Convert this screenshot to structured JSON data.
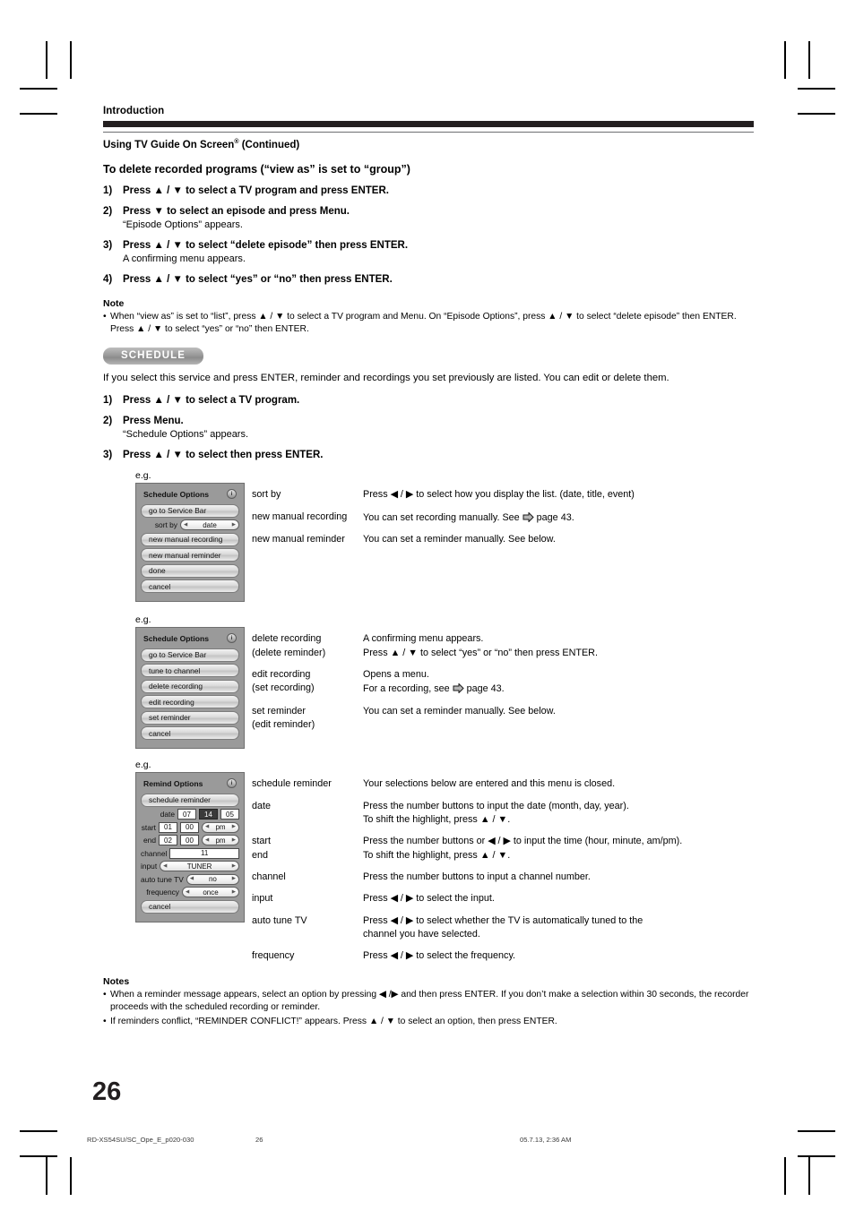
{
  "running_head": "Introduction",
  "section_title_main": "Using TV Guide On Screen",
  "section_title_sup": "®",
  "section_title_tail": " (Continued)",
  "subhead": "To delete recorded programs (“view as” is set to “group”)",
  "steps_top": [
    {
      "num": "1)",
      "text": "Press ▲ / ▼ to select a TV program and press ENTER.",
      "sub": null
    },
    {
      "num": "2)",
      "text": "Press ▼ to select an episode and press Menu.",
      "sub": "“Episode Options” appears."
    },
    {
      "num": "3)",
      "text": "Press ▲ / ▼ to select “delete episode” then press ENTER.",
      "sub": "A confirming menu appears."
    },
    {
      "num": "4)",
      "text": "Press ▲ / ▼ to select “yes” or “no” then press ENTER.",
      "sub": null
    }
  ],
  "note_heading": "Note",
  "note_items": [
    "When “view as” is set to “list”, press ▲ / ▼ to select a TV program and Menu. On “Episode Options”, press ▲ / ▼ to select “delete episode” then ENTER. Press ▲ / ▼ to select “yes” or “no” then ENTER."
  ],
  "badge_label": "SCHEDULE",
  "badge_color": "#9e9e9e",
  "intro_paragraph": "If you select this service and press ENTER, reminder and recordings you set previously are listed. You can edit or delete them.",
  "steps_schedule": [
    {
      "num": "1)",
      "text": "Press ▲ / ▼ to select a TV program.",
      "sub": null
    },
    {
      "num": "2)",
      "text": "Press Menu.",
      "sub": "“Schedule Options” appears."
    },
    {
      "num": "3)",
      "text": "Press ▲ / ▼ to select then press ENTER.",
      "sub": null
    }
  ],
  "eg_label": "e.g.",
  "menu1": {
    "title": "Schedule Options",
    "info_icon_glyph": "i",
    "items": [
      {
        "type": "button",
        "label": "go to Service Bar"
      },
      {
        "type": "select",
        "label": "sort by",
        "value": "date"
      },
      {
        "type": "button",
        "label": "new manual recording"
      },
      {
        "type": "button",
        "label": "new manual reminder"
      },
      {
        "type": "button",
        "label": "done"
      },
      {
        "type": "button",
        "label": "cancel"
      }
    ]
  },
  "desc1": [
    {
      "term": "sort by",
      "term2": null,
      "lines": [
        "Press ◀ / ▶ to select how you display the list. (date, title, event)"
      ]
    },
    {
      "term": "new manual recording",
      "term2": null,
      "lines": [
        "You can set recording manually. See  PAGEARROW  page 43."
      ],
      "page_ref": "page 43."
    },
    {
      "term": "new manual reminder",
      "term2": null,
      "lines": [
        "You can set a reminder manually. See below."
      ]
    }
  ],
  "menu2": {
    "title": "Schedule Options",
    "info_icon_glyph": "i",
    "items": [
      {
        "type": "button",
        "label": "go to Service Bar"
      },
      {
        "type": "button",
        "label": "tune to channel"
      },
      {
        "type": "button",
        "label": "delete recording"
      },
      {
        "type": "button",
        "label": "edit recording"
      },
      {
        "type": "button",
        "label": "set reminder"
      },
      {
        "type": "button",
        "label": "cancel"
      }
    ]
  },
  "desc2": [
    {
      "term": "delete recording",
      "term2": "(delete reminder)",
      "lines": [
        "A confirming menu appears.",
        "Press ▲ / ▼ to select “yes” or “no” then press ENTER."
      ]
    },
    {
      "term": "edit recording",
      "term2": "(set recording)",
      "lines": [
        "Opens a menu.",
        "For a recording, see  PAGEARROW  page 43."
      ]
    },
    {
      "term": "set reminder",
      "term2": "(edit reminder)",
      "lines": [
        "You can set a reminder manually. See below."
      ]
    }
  ],
  "menu3": {
    "title": "Remind Options",
    "info_icon_glyph": "i",
    "schedule_button": "schedule reminder",
    "date": {
      "label": "date",
      "month": "07",
      "day": "14",
      "year": "05",
      "selected_field": "day"
    },
    "start": {
      "label": "start",
      "hour": "01",
      "minute": "00",
      "meridiem": "pm"
    },
    "end": {
      "label": "end",
      "hour": "02",
      "minute": "00",
      "meridiem": "pm"
    },
    "channel": {
      "label": "channel",
      "value": "11"
    },
    "input": {
      "label": "input",
      "value": "TUNER"
    },
    "auto_tune": {
      "label": "auto tune TV",
      "value": "no"
    },
    "frequency": {
      "label": "frequency",
      "value": "once"
    },
    "cancel": "cancel"
  },
  "desc3": [
    {
      "term": "schedule reminder",
      "term2": null,
      "lines": [
        "Your selections below are entered and this menu is closed."
      ]
    },
    {
      "term": "date",
      "term2": null,
      "lines": [
        "Press the number buttons to input the date (month, day, year).",
        "To shift the highlight, press ▲ / ▼."
      ]
    },
    {
      "term": "start",
      "term2": "end",
      "lines": [
        "Press the number buttons or ◀ / ▶ to input the time (hour, minute, am/pm).",
        "To shift the highlight, press ▲ / ▼."
      ]
    },
    {
      "term": "channel",
      "term2": null,
      "lines": [
        "Press the number buttons to input a channel number."
      ]
    },
    {
      "term": "input",
      "term2": null,
      "lines": [
        "Press ◀ / ▶ to select the input."
      ]
    },
    {
      "term": "auto tune TV",
      "term2": null,
      "lines": [
        "Press ◀ / ▶ to select whether the TV is automatically tuned to the",
        "channel you have selected."
      ]
    },
    {
      "term": "frequency",
      "term2": null,
      "lines": [
        "Press ◀ / ▶ to select the frequency."
      ]
    }
  ],
  "notes_heading": "Notes",
  "notes_items": [
    "When a reminder message appears, select an option by pressing ◀ /▶ and then press ENTER. If you don’t make a selection within 30 seconds, the recorder proceeds with the scheduled recording or reminder.",
    "If reminders conflict, “REMINDER CONFLICT!” appears. Press ▲ / ▼ to select an option, then press ENTER."
  ],
  "page_number": "26",
  "footer": {
    "file": "RD-XS54SU/SC_Ope_E_p020-030",
    "page": "26",
    "timestamp": "05.7.13, 2:36 AM"
  }
}
